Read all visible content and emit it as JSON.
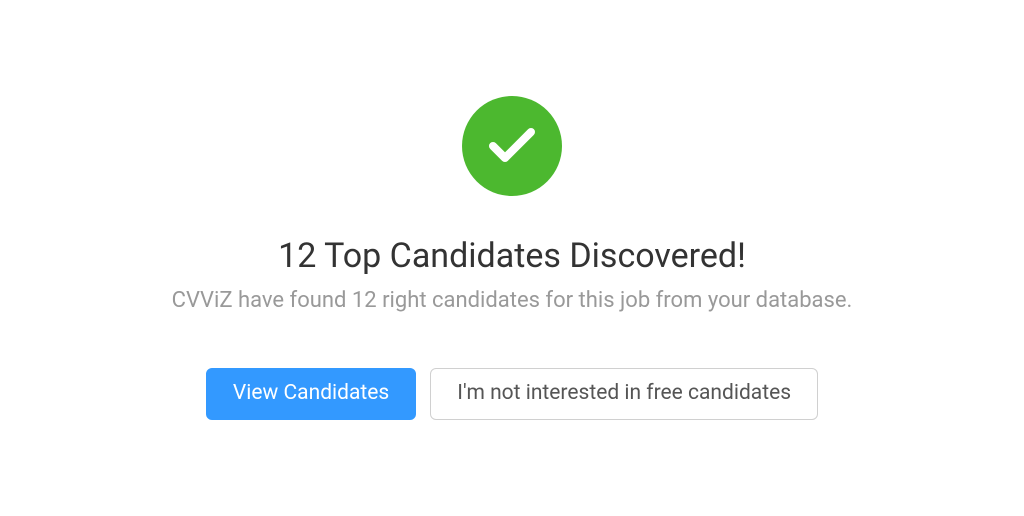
{
  "dialog": {
    "title": "12 Top Candidates Discovered!",
    "subtitle": "CVViZ have found 12 right candidates for this job from your database.",
    "primary_button": "View Candidates",
    "secondary_button": "I'm not interested in free candidates"
  },
  "colors": {
    "success": "#4CB82F",
    "primary": "#3399FF",
    "text_dark": "#333333",
    "text_muted": "#999999"
  }
}
